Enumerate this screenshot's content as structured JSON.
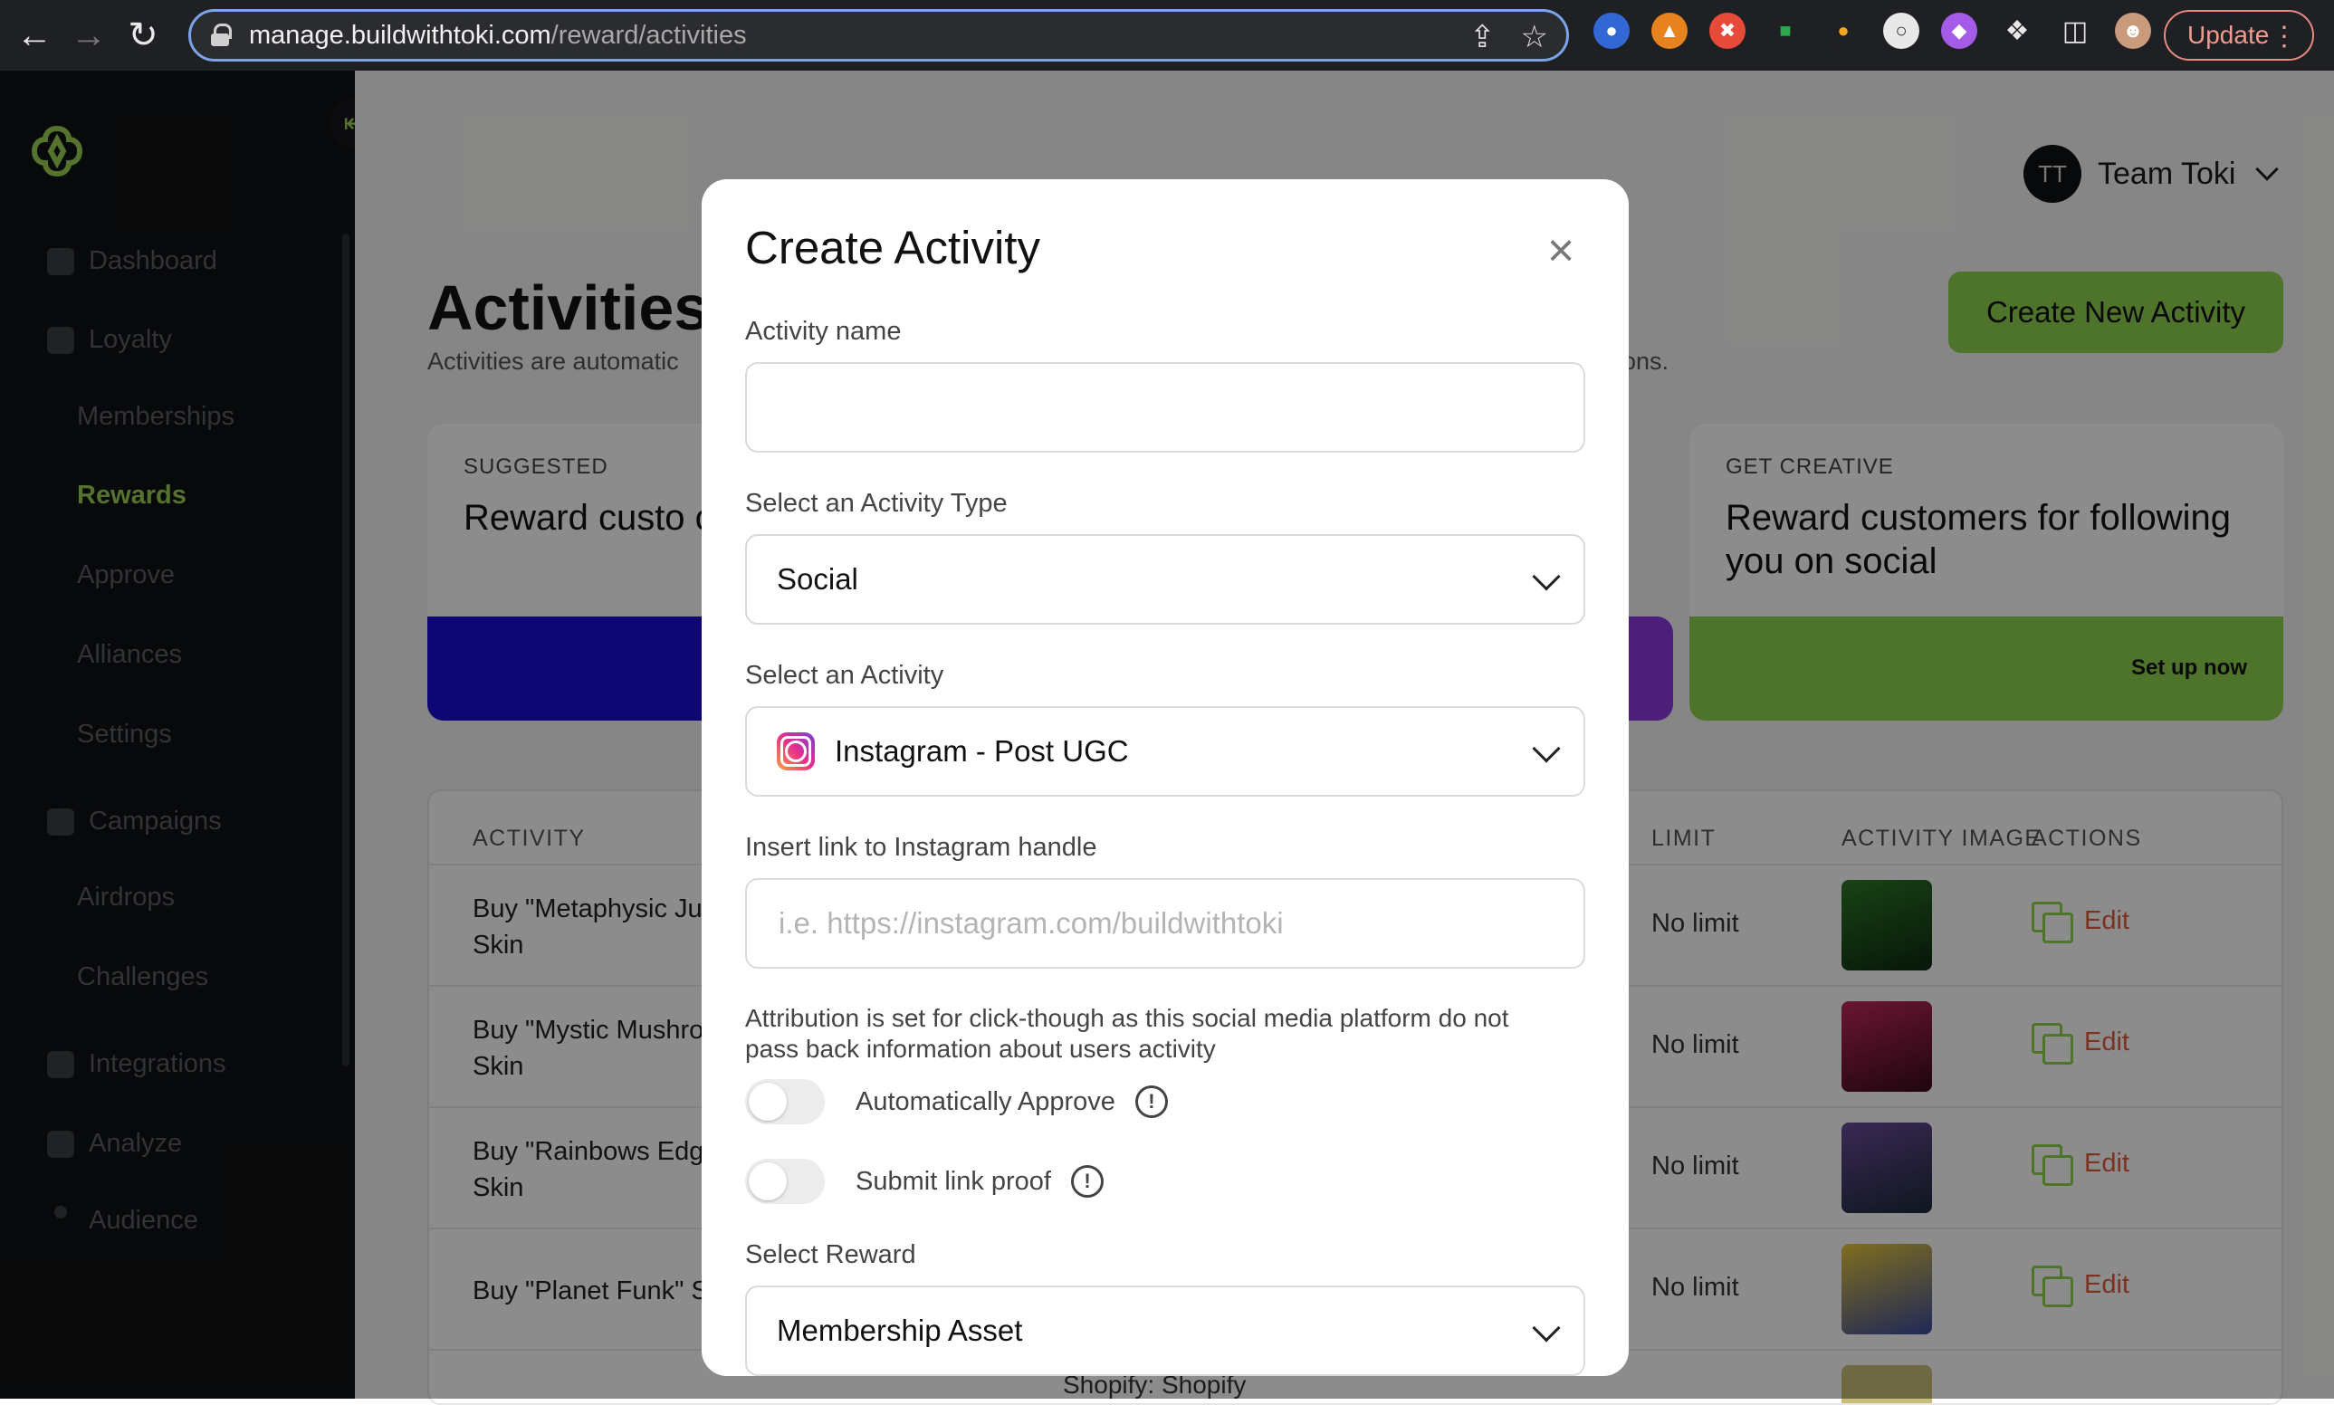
{
  "browser": {
    "url_host": "manage.buildwithtoki.com",
    "url_path": "/reward/activities",
    "update_label": "Update"
  },
  "sidebar": {
    "items": [
      {
        "label": "Dashboard"
      },
      {
        "label": "Loyalty"
      },
      {
        "label": "Memberships"
      },
      {
        "label": "Rewards"
      },
      {
        "label": "Approve"
      },
      {
        "label": "Alliances"
      },
      {
        "label": "Settings"
      },
      {
        "label": "Campaigns"
      },
      {
        "label": "Airdrops"
      },
      {
        "label": "Challenges"
      },
      {
        "label": "Integrations"
      },
      {
        "label": "Analyze"
      },
      {
        "label": "Audience"
      }
    ]
  },
  "header": {
    "avatar_initials": "TT",
    "team_name": "Team Toki",
    "page_title": "Activities",
    "page_sub": "Activities are automatic",
    "page_sub_tail": "ons.",
    "create_button": "Create New Activity"
  },
  "cards": [
    {
      "label": "SUGGESTED",
      "heading": "Reward custo completing th"
    },
    {
      "label": "GET CREATIVE",
      "heading": "Reward customers for following you on social",
      "action": "Set up now"
    }
  ],
  "table": {
    "headers": {
      "activity": "ACTIVITY",
      "limit": "LIMIT",
      "image": "ACTIVITY IMAGE",
      "actions": "ACTIONS"
    },
    "rows": [
      {
        "activity": "Buy \"Metaphysic Ju Skin",
        "limit": "No limit",
        "edit": "Edit",
        "thumb_color": "#1f5a1c"
      },
      {
        "activity": "Buy \"Mystic Mushro Skin",
        "limit": "No limit",
        "edit": "Edit",
        "thumb_color": "#8a1c3c"
      },
      {
        "activity": "Buy \"Rainbows Edg Skin",
        "limit": "No limit",
        "edit": "Edit",
        "thumb_color": "#4a3a6a"
      },
      {
        "activity": "Buy \"Planet Funk\" S",
        "limit": "No limit",
        "edit": "Edit",
        "thumb_color": "#3a4aa0"
      }
    ],
    "footer_peek": "Shopify: Shopify"
  },
  "modal": {
    "title": "Create Activity",
    "activity_name_label": "Activity name",
    "activity_name_value": "",
    "activity_type_label": "Select an Activity Type",
    "activity_type_value": "Social",
    "activity_label": "Select an Activity",
    "activity_value": "Instagram - Post UGC",
    "handle_label": "Insert link to Instagram handle",
    "handle_placeholder": "i.e. https://instagram.com/buildwithtoki",
    "attribution_note": "Attribution is set for click-though as this social media platform do not pass back information about users activity",
    "auto_approve_label": "Automatically Approve",
    "submit_proof_label": "Submit link proof",
    "reward_label": "Select Reward",
    "reward_value": "Membership Asset"
  },
  "colors": {
    "accent_green": "#8fd14f",
    "sidebar_bg": "#101113",
    "edit_red": "#e15b3b",
    "suggested_blue": "#1a0bd0"
  }
}
